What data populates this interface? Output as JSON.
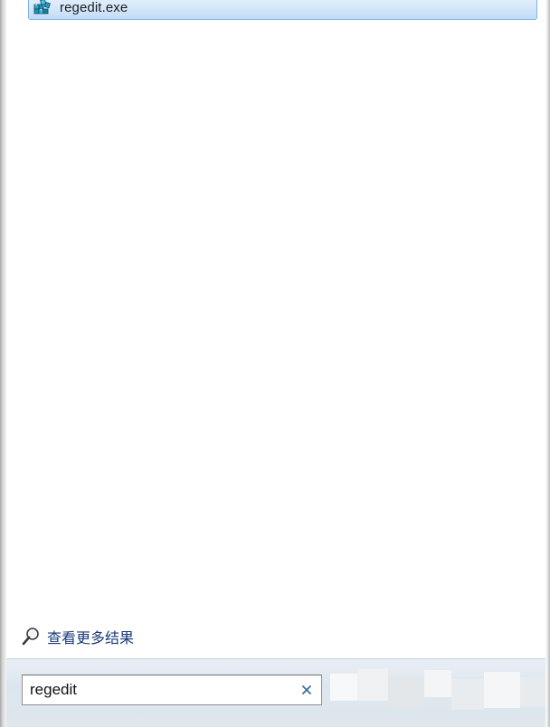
{
  "search_results": {
    "items": [
      {
        "label": "regedit.exe",
        "icon": "registry-editor-icon"
      }
    ]
  },
  "more_results": {
    "label": "查看更多结果",
    "icon": "search-magnifier-icon"
  },
  "search": {
    "value": "regedit",
    "clear_icon": "clear-x-icon"
  },
  "colors": {
    "highlight": "#d6e8fa",
    "highlight_border": "#7eb4ea",
    "link_text": "#1a3a7a",
    "search_bar_bg": "#dde6ef",
    "clear_x": "#3a6ea5"
  }
}
